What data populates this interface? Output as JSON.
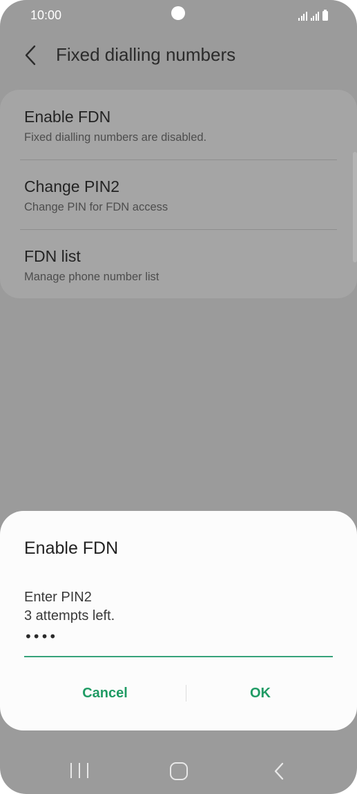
{
  "status_bar": {
    "time": "10:00",
    "icons": [
      "signal-sim1-icon",
      "signal-sim2-icon",
      "battery-icon"
    ]
  },
  "header": {
    "back_icon": "chevron-left-icon",
    "title": "Fixed dialling numbers"
  },
  "settings": {
    "items": [
      {
        "title": "Enable FDN",
        "subtitle": "Fixed dialling numbers are disabled."
      },
      {
        "title": "Change PIN2",
        "subtitle": "Change PIN for FDN access"
      },
      {
        "title": "FDN list",
        "subtitle": "Manage phone number list"
      }
    ]
  },
  "dialog": {
    "title": "Enable FDN",
    "prompt": "Enter PIN2",
    "attempts": "3 attempts left.",
    "pin_value": "••••",
    "cancel_label": "Cancel",
    "ok_label": "OK"
  },
  "nav_bar": {
    "recent_icon": "recent-apps-icon",
    "home_icon": "home-icon",
    "back_icon": "back-icon"
  },
  "colors": {
    "accent": "#1f9b64",
    "underline": "#35a27a",
    "scrim": "#9b9b9b",
    "dialog_bg": "#fcfcfc"
  }
}
